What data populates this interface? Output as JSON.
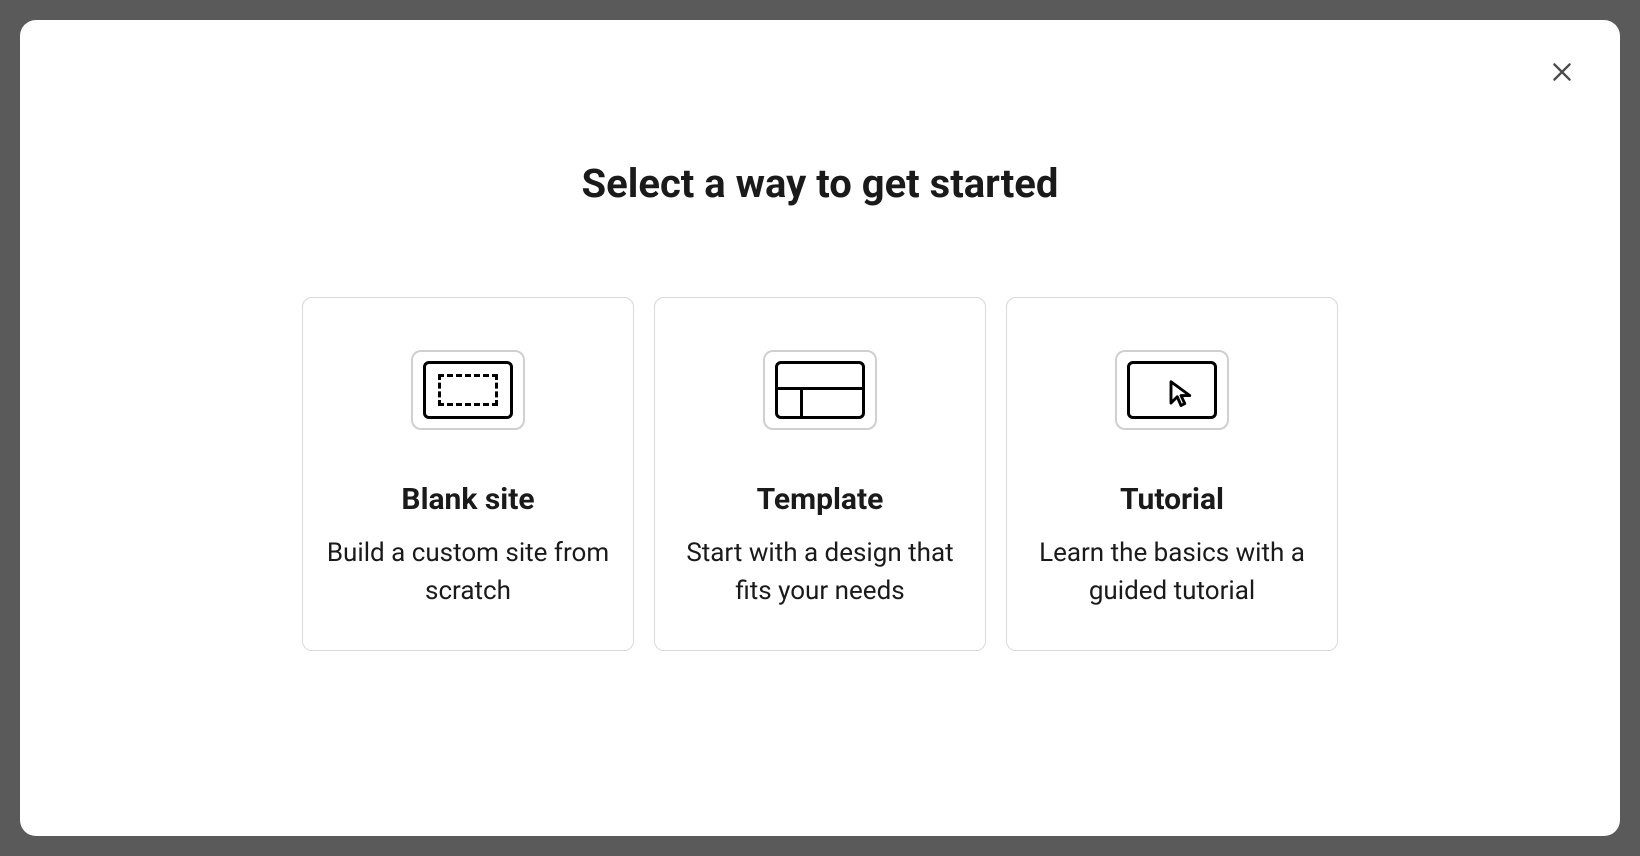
{
  "modal": {
    "title": "Select a way to get started",
    "options": [
      {
        "title": "Blank site",
        "description": "Build a custom site from scratch"
      },
      {
        "title": "Template",
        "description": "Start with a design that fits your needs"
      },
      {
        "title": "Tutorial",
        "description": "Learn the basics with a guided tutorial"
      }
    ]
  }
}
